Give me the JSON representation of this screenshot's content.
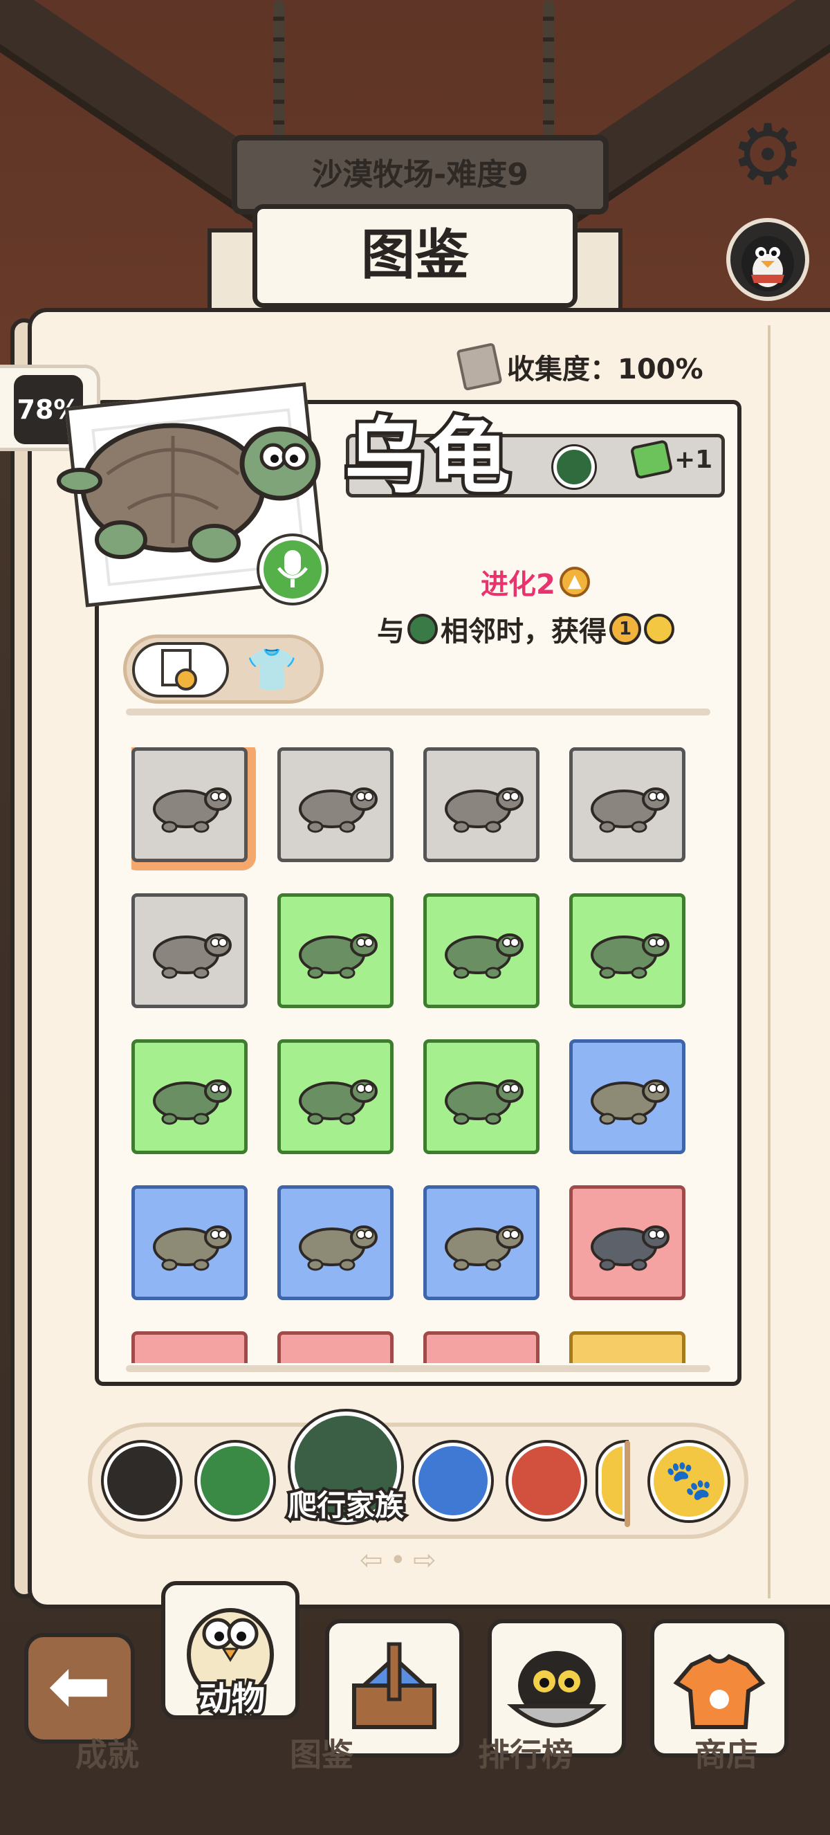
{
  "level_sign": "沙漠牧场-难度9",
  "title": "图鉴",
  "collection": {
    "label": "收集度：100%"
  },
  "completion_badge": "78%",
  "animal": {
    "name": "乌龟",
    "bonus": "+1",
    "evolve": "进化2",
    "skill_prefix": "与",
    "skill_suffix": "相邻时，获得",
    "skill_value": "1"
  },
  "grid": {
    "cells": [
      {
        "name": "turtle",
        "color": "gray",
        "selected": true
      },
      {
        "name": "gecko",
        "color": "gray"
      },
      {
        "name": "egg-snake",
        "color": "gray"
      },
      {
        "name": "lizard",
        "color": "gray"
      },
      {
        "name": "shadow-creature",
        "color": "gray"
      },
      {
        "name": "chameleon",
        "color": "green"
      },
      {
        "name": "cobra",
        "color": "green"
      },
      {
        "name": "iguana",
        "color": "green"
      },
      {
        "name": "snapping-turtle",
        "color": "green"
      },
      {
        "name": "crocodile",
        "color": "green"
      },
      {
        "name": "spotted-snake",
        "color": "green"
      },
      {
        "name": "salamander",
        "color": "blue"
      },
      {
        "name": "yellow-cobra",
        "color": "blue"
      },
      {
        "name": "horned-viper",
        "color": "blue"
      },
      {
        "name": "sea-turtle",
        "color": "blue"
      },
      {
        "name": "komodo",
        "color": "red"
      },
      {
        "name": "partial-red-1",
        "color": "red"
      },
      {
        "name": "partial-red-2",
        "color": "red"
      },
      {
        "name": "partial-red-3",
        "color": "red"
      },
      {
        "name": "partial-yellow",
        "color": "yellow"
      }
    ]
  },
  "category_tabs": {
    "active_label": "爬行家族",
    "tabs": [
      "cat-face",
      "green-blob",
      "reptile-family",
      "blue-blob",
      "red-fish",
      "partial"
    ],
    "paw": "🐾"
  },
  "nav": {
    "back": "achievement",
    "items": [
      {
        "label": "动物",
        "shadow": "成就"
      },
      {
        "label": "",
        "shadow": "图鉴"
      },
      {
        "label": "",
        "shadow": "排行榜"
      },
      {
        "label": "",
        "shadow": "商店"
      }
    ]
  },
  "colors": {
    "accent_pink": "#e8336f",
    "cell_gray": "#d6d3cf",
    "cell_green": "#a5ef8f",
    "cell_blue": "#8fb5f4",
    "cell_red": "#f4a2a2",
    "cell_yellow": "#f6cc66"
  }
}
